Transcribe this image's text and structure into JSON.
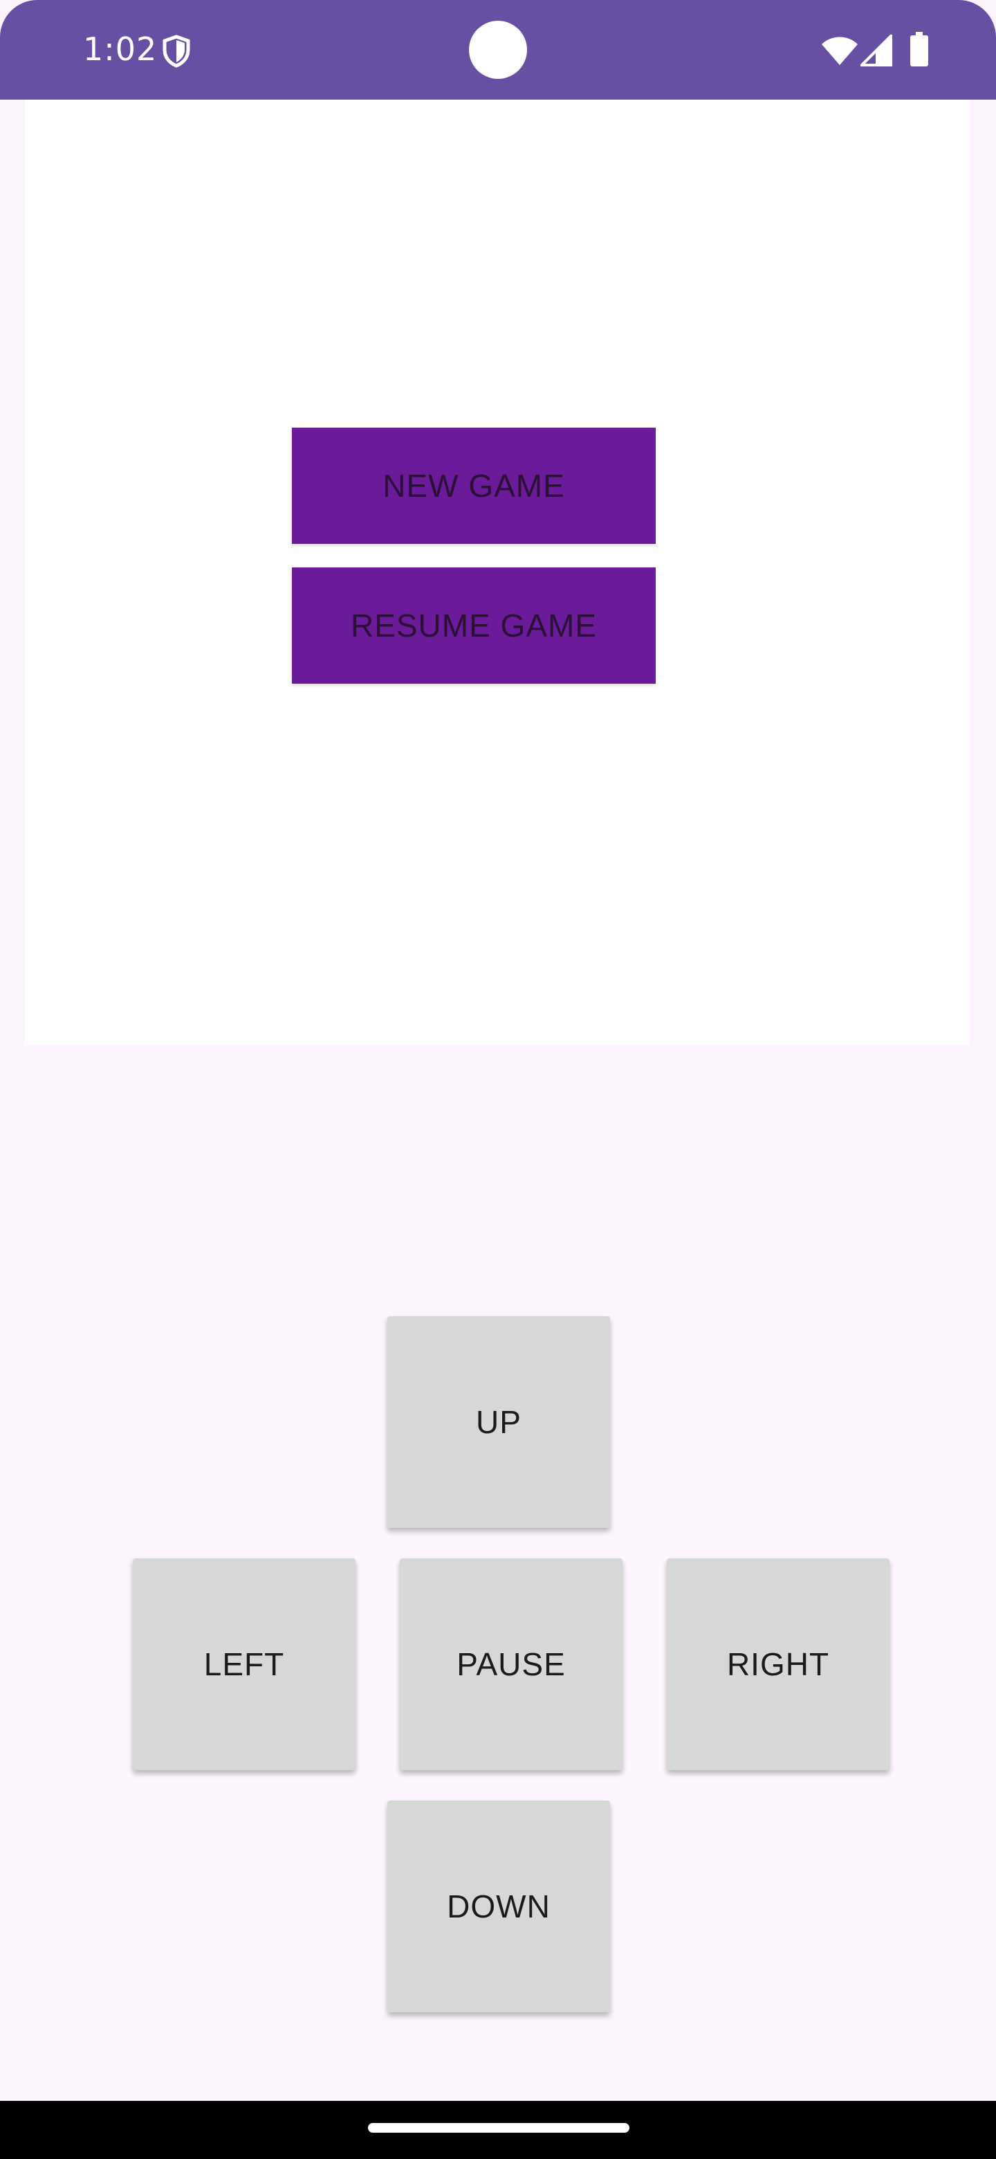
{
  "status_bar": {
    "time": "1:02",
    "background_color": "#6750A4",
    "icons": [
      "shield-icon",
      "wifi-icon",
      "signal-icon",
      "battery-icon"
    ]
  },
  "game_menu": {
    "new_game_label": "NEW GAME",
    "resume_game_label": "RESUME GAME",
    "button_color": "#6A1B9A"
  },
  "controls": {
    "up_label": "UP",
    "left_label": "LEFT",
    "pause_label": "PAUSE",
    "right_label": "RIGHT",
    "down_label": "DOWN",
    "button_color": "#D6D7D7"
  },
  "theme": {
    "background": "#FDF5FE",
    "board_background": "#FFFFFF"
  }
}
